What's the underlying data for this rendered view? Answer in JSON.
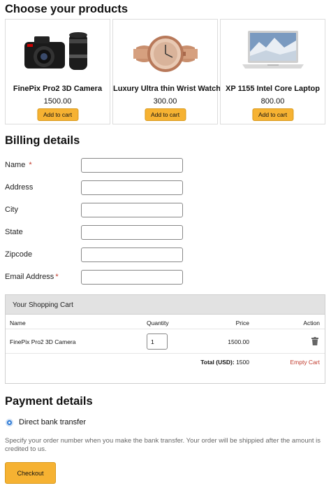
{
  "products_section": {
    "title": "Choose your products"
  },
  "products": [
    {
      "name": "FinePix Pro2 3D Camera",
      "price": "1500.00",
      "button": "Add to cart",
      "icon": "camera-image"
    },
    {
      "name": "Luxury Ultra thin Wrist Watch",
      "price": "300.00",
      "button": "Add to cart",
      "icon": "watch-image"
    },
    {
      "name": "XP 1155 Intel Core Laptop",
      "price": "800.00",
      "button": "Add to cart",
      "icon": "laptop-image"
    }
  ],
  "billing": {
    "title": "Billing details",
    "fields": [
      {
        "label": "Name",
        "required": true,
        "value": ""
      },
      {
        "label": "Address",
        "required": false,
        "value": ""
      },
      {
        "label": "City",
        "required": false,
        "value": ""
      },
      {
        "label": "State",
        "required": false,
        "value": ""
      },
      {
        "label": "Zipcode",
        "required": false,
        "value": ""
      },
      {
        "label": "Email Address",
        "required": true,
        "value": ""
      }
    ],
    "required_mark": "*"
  },
  "cart": {
    "title": "Your Shopping Cart",
    "headers": {
      "name": "Name",
      "quantity": "Quantity",
      "price": "Price",
      "action": "Action"
    },
    "items": [
      {
        "name": "FinePix Pro2 3D Camera",
        "quantity": "1",
        "price": "1500.00"
      }
    ],
    "total_label": "Total (USD):",
    "total_value": "1500",
    "empty_label": "Empty Cart"
  },
  "payment": {
    "title": "Payment details",
    "method": "Direct bank transfer",
    "note": "Specify your order number when you make the bank transfer. Your order will be shippied after the amount is credited to us.",
    "checkout": "Checkout"
  },
  "colors": {
    "accent": "#f6b232",
    "danger": "#c0392b",
    "radio": "#2e7bd6"
  }
}
